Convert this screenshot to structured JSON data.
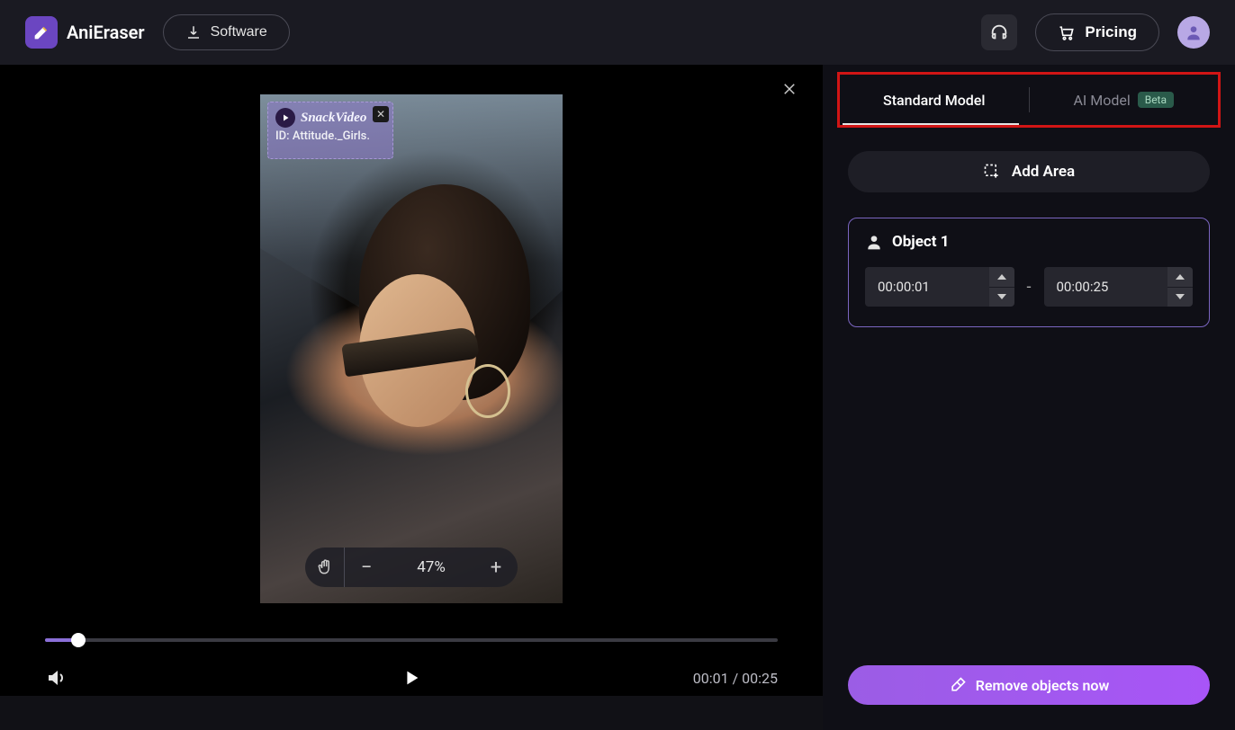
{
  "header": {
    "app_name": "AniEraser",
    "software_label": "Software",
    "pricing_label": "Pricing"
  },
  "preview": {
    "watermark_brand": "SnackVideo",
    "watermark_id": "ID: Attitude._Girls.",
    "zoom_value": "47%"
  },
  "playback": {
    "current": "00:01",
    "duration": "00:25",
    "separator": " / "
  },
  "panel": {
    "tab_standard": "Standard Model",
    "tab_ai": "AI Model",
    "beta_label": "Beta",
    "add_area_label": "Add Area",
    "object_title": "Object 1",
    "time_start": "00:00:01",
    "time_end": "00:00:25",
    "remove_label": "Remove objects now"
  }
}
